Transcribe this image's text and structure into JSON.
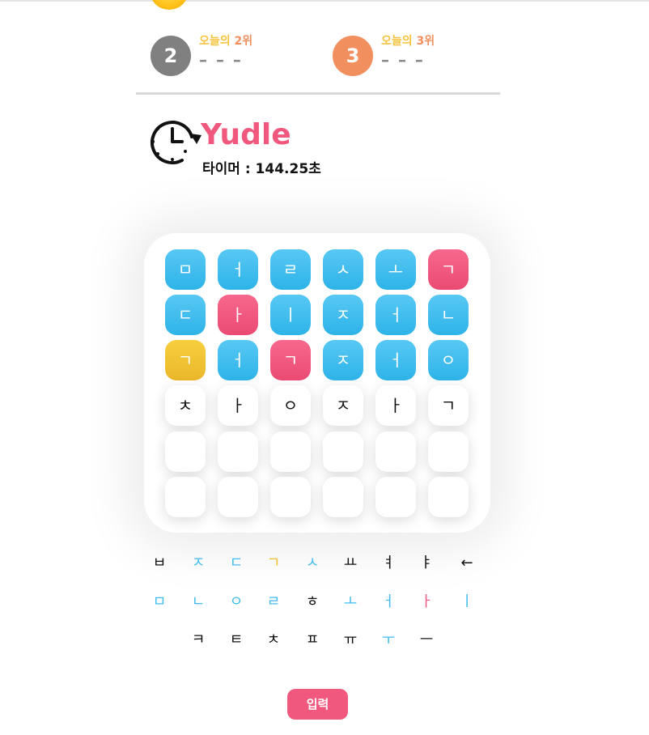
{
  "ranking": {
    "second": {
      "badge": "2",
      "label_prefix": "오늘의 ",
      "label_rank": "2위",
      "player": "– – –",
      "color": "#808080"
    },
    "third": {
      "badge": "3",
      "label_prefix": "오늘의 ",
      "label_rank": "3위",
      "player": "– – –",
      "color": "#f28f5e"
    }
  },
  "game": {
    "title": "Yudle",
    "timer": "타이머 : 144.25초"
  },
  "colors": {
    "correct": "#f0587e",
    "present": "#f2c235",
    "absent": "#3fbcee",
    "empty": "#ffffff"
  },
  "board": [
    [
      {
        "ch": "ㅁ",
        "s": "blue"
      },
      {
        "ch": "ㅓ",
        "s": "blue"
      },
      {
        "ch": "ㄹ",
        "s": "blue"
      },
      {
        "ch": "ㅅ",
        "s": "blue"
      },
      {
        "ch": "ㅗ",
        "s": "blue"
      },
      {
        "ch": "ㄱ",
        "s": "pink"
      }
    ],
    [
      {
        "ch": "ㄷ",
        "s": "blue"
      },
      {
        "ch": "ㅏ",
        "s": "pink"
      },
      {
        "ch": "ㅣ",
        "s": "blue"
      },
      {
        "ch": "ㅈ",
        "s": "blue"
      },
      {
        "ch": "ㅓ",
        "s": "blue"
      },
      {
        "ch": "ㄴ",
        "s": "blue"
      }
    ],
    [
      {
        "ch": "ㄱ",
        "s": "yellow"
      },
      {
        "ch": "ㅓ",
        "s": "blue"
      },
      {
        "ch": "ㄱ",
        "s": "pink"
      },
      {
        "ch": "ㅈ",
        "s": "blue"
      },
      {
        "ch": "ㅓ",
        "s": "blue"
      },
      {
        "ch": "ㅇ",
        "s": "blue"
      }
    ],
    [
      {
        "ch": "ㅊ",
        "s": "empty"
      },
      {
        "ch": "ㅏ",
        "s": "empty"
      },
      {
        "ch": "ㅇ",
        "s": "empty"
      },
      {
        "ch": "ㅈ",
        "s": "empty"
      },
      {
        "ch": "ㅏ",
        "s": "empty"
      },
      {
        "ch": "ㄱ",
        "s": "empty"
      }
    ],
    [
      {
        "ch": "",
        "s": "empty"
      },
      {
        "ch": "",
        "s": "empty"
      },
      {
        "ch": "",
        "s": "empty"
      },
      {
        "ch": "",
        "s": "empty"
      },
      {
        "ch": "",
        "s": "empty"
      },
      {
        "ch": "",
        "s": "empty"
      }
    ],
    [
      {
        "ch": "",
        "s": "empty"
      },
      {
        "ch": "",
        "s": "empty"
      },
      {
        "ch": "",
        "s": "empty"
      },
      {
        "ch": "",
        "s": "empty"
      },
      {
        "ch": "",
        "s": "empty"
      },
      {
        "ch": "",
        "s": "empty"
      }
    ]
  ],
  "keyboard": [
    [
      {
        "k": "ㅂ",
        "c": "#111111"
      },
      {
        "k": "ㅈ",
        "c": "#3fbcee"
      },
      {
        "k": "ㄷ",
        "c": "#3fbcee"
      },
      {
        "k": "ㄱ",
        "c": "#f2c235"
      },
      {
        "k": "ㅅ",
        "c": "#3fbcee"
      },
      {
        "k": "ㅛ",
        "c": "#111111"
      },
      {
        "k": "ㅕ",
        "c": "#111111"
      },
      {
        "k": "ㅑ",
        "c": "#111111"
      },
      {
        "k": "←",
        "c": "#111111",
        "name": "backspace-key"
      }
    ],
    [
      {
        "k": "ㅁ",
        "c": "#3fbcee"
      },
      {
        "k": "ㄴ",
        "c": "#3fbcee"
      },
      {
        "k": "ㅇ",
        "c": "#3fbcee"
      },
      {
        "k": "ㄹ",
        "c": "#3fbcee"
      },
      {
        "k": "ㅎ",
        "c": "#111111"
      },
      {
        "k": "ㅗ",
        "c": "#3fbcee"
      },
      {
        "k": "ㅓ",
        "c": "#3fbcee"
      },
      {
        "k": "ㅏ",
        "c": "#f0587e"
      },
      {
        "k": "ㅣ",
        "c": "#3fbcee"
      }
    ],
    [
      {
        "k": "ㅋ",
        "c": "#111111"
      },
      {
        "k": "ㅌ",
        "c": "#111111"
      },
      {
        "k": "ㅊ",
        "c": "#111111"
      },
      {
        "k": "ㅍ",
        "c": "#111111"
      },
      {
        "k": "ㅠ",
        "c": "#111111"
      },
      {
        "k": "ㅜ",
        "c": "#3fbcee"
      },
      {
        "k": "ㅡ",
        "c": "#111111"
      }
    ]
  ],
  "submit_label": "입력"
}
